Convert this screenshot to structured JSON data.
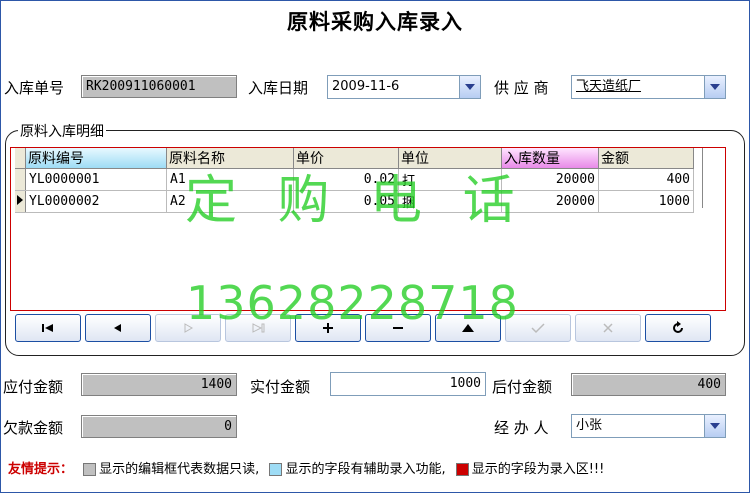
{
  "title": "原料采购入库录入",
  "header": {
    "order_no_label": "入库单号",
    "order_no_value": "RK200911060001",
    "date_label": "入库日期",
    "date_value": "2009-11-6",
    "supplier_label": "供 应 商",
    "supplier_value": "飞天造纸厂"
  },
  "detail": {
    "group_title": "原料入库明细",
    "columns": [
      "原料编号",
      "原料名称",
      "单价",
      "单位",
      "入库数量",
      "金额"
    ],
    "rows": [
      {
        "code": "YL0000001",
        "name": "A1",
        "price": "0.02",
        "unit": "打",
        "qty": "20000",
        "amount": "400"
      },
      {
        "code": "YL0000002",
        "name": "A2",
        "price": "0.05",
        "unit": "捆",
        "qty": "20000",
        "amount": "1000"
      }
    ],
    "current_row_index": 1
  },
  "nav_buttons": [
    {
      "name": "first",
      "icon": "first-record-icon",
      "enabled": true
    },
    {
      "name": "prior",
      "icon": "prior-record-icon",
      "enabled": true
    },
    {
      "name": "next",
      "icon": "next-record-icon",
      "enabled": false
    },
    {
      "name": "last",
      "icon": "last-record-icon",
      "enabled": false
    },
    {
      "name": "insert",
      "icon": "plus-icon",
      "enabled": true
    },
    {
      "name": "delete",
      "icon": "minus-icon",
      "enabled": true
    },
    {
      "name": "edit",
      "icon": "up-triangle-icon",
      "enabled": true
    },
    {
      "name": "post",
      "icon": "check-icon",
      "enabled": false
    },
    {
      "name": "cancel",
      "icon": "x-icon",
      "enabled": false
    },
    {
      "name": "refresh",
      "icon": "refresh-icon",
      "enabled": true
    }
  ],
  "totals": {
    "payable_label": "应付金额",
    "payable_value": "1400",
    "paid_label": "实付金额",
    "paid_value": "1000",
    "after_label": "后付金额",
    "after_value": "400",
    "owed_label": "欠款金额",
    "owed_value": "0",
    "handler_label": "经 办 人",
    "handler_value": "小张"
  },
  "watermark": {
    "line1": "定 购 电 话",
    "line2": "13628228718"
  },
  "tips": {
    "label": "友情提示：",
    "gray_text": "显示的编辑框代表数据只读,",
    "cyan_text": "显示的字段有辅助录入功能,",
    "red_text": "显示的字段为录入区!!!"
  },
  "colors": {
    "readonly_gray": "#c0c0c0",
    "helper_cyan": "#9edcf5",
    "input_red": "#cc0000",
    "watermark_green": "#22cd22",
    "tip_red": "#cc0000"
  }
}
